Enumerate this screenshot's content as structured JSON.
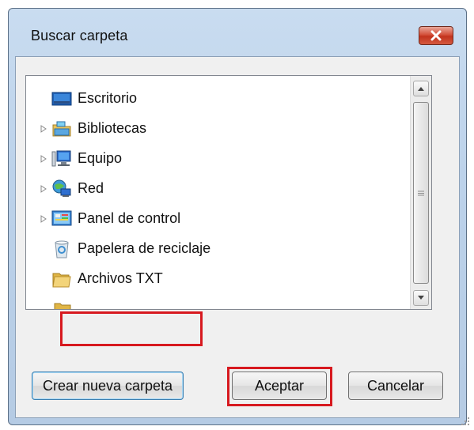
{
  "window": {
    "title": "Buscar carpeta"
  },
  "tree": {
    "items": [
      {
        "label": "Escritorio",
        "icon": "desktop-icon",
        "expandable": false
      },
      {
        "label": "Bibliotecas",
        "icon": "libraries-icon",
        "expandable": true
      },
      {
        "label": "Equipo",
        "icon": "computer-icon",
        "expandable": true
      },
      {
        "label": "Red",
        "icon": "network-icon",
        "expandable": true
      },
      {
        "label": "Panel de control",
        "icon": "control-panel-icon",
        "expandable": true
      },
      {
        "label": "Papelera de reciclaje",
        "icon": "recycle-bin-icon",
        "expandable": false
      },
      {
        "label": "Archivos TXT",
        "icon": "folder-icon",
        "expandable": false,
        "highlighted": true
      }
    ]
  },
  "buttons": {
    "new_folder": "Crear nueva carpeta",
    "ok": "Aceptar",
    "cancel": "Cancelar"
  },
  "colors": {
    "highlight": "#d7191f",
    "title_gradient": "#c9dcf0",
    "close_button": "#c2331d"
  }
}
